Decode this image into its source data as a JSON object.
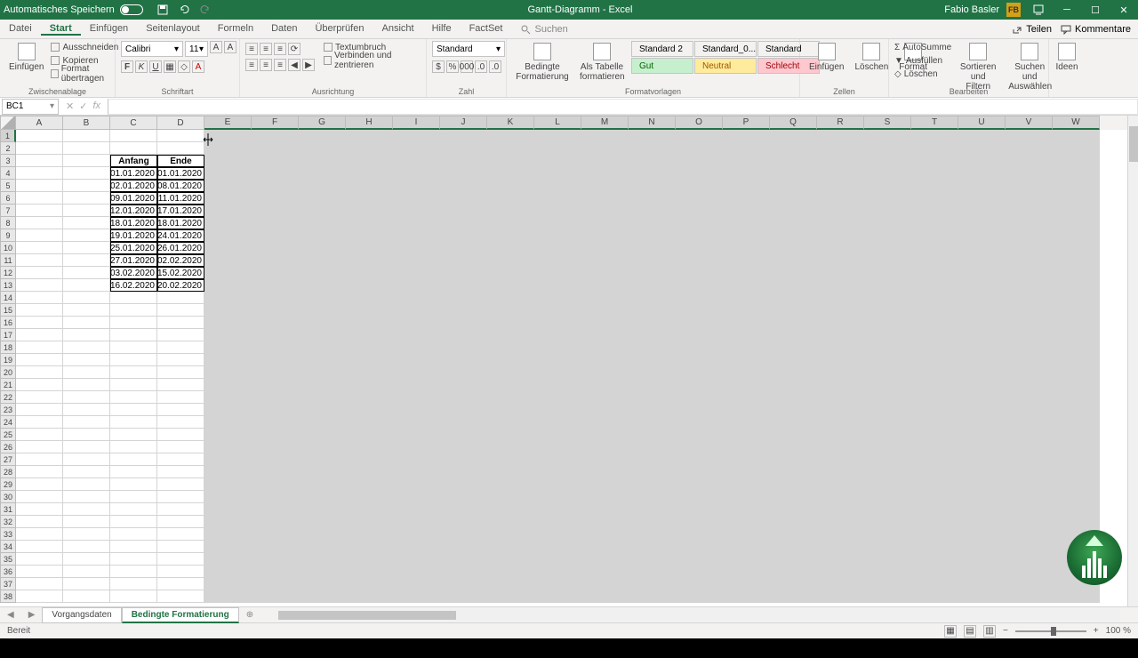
{
  "titlebar": {
    "autosave": "Automatisches Speichern",
    "title": "Gantt-Diagramm - Excel",
    "user": "Fabio Basler",
    "user_initials": "FB"
  },
  "tabs": {
    "items": [
      "Datei",
      "Start",
      "Einfügen",
      "Seitenlayout",
      "Formeln",
      "Daten",
      "Überprüfen",
      "Ansicht",
      "Hilfe",
      "FactSet"
    ],
    "active": 1,
    "search": "Suchen",
    "share": "Teilen",
    "comments": "Kommentare"
  },
  "ribbon": {
    "paste": "Einfügen",
    "cut": "Ausschneiden",
    "copy": "Kopieren",
    "formatpainter": "Format übertragen",
    "clipboard": "Zwischenablage",
    "font": "Schriftart",
    "fontname": "Calibri",
    "fontsize": "11",
    "alignment": "Ausrichtung",
    "wrap": "Textumbruch",
    "merge": "Verbinden und zentrieren",
    "number": "Zahl",
    "numberformat": "Standard",
    "conditional": "Bedingte Formatierung",
    "astable": "Als Tabelle formatieren",
    "styles_label": "Formatvorlagen",
    "styles": [
      {
        "name": "Standard 2"
      },
      {
        "name": "Standard_0..."
      },
      {
        "name": "Standard"
      },
      {
        "name": "Gut"
      },
      {
        "name": "Neutral"
      },
      {
        "name": "Schlecht"
      }
    ],
    "insert": "Einfügen",
    "delete": "Löschen",
    "format": "Format",
    "cells": "Zellen",
    "autosum": "AutoSumme",
    "fill": "Ausfüllen",
    "clear": "Löschen",
    "sort": "Sortieren und Filtern",
    "find": "Suchen und Auswählen",
    "editing": "Bearbeiten",
    "ideas": "Ideen"
  },
  "namebox": "BC1",
  "columns": [
    "A",
    "B",
    "C",
    "D",
    "E",
    "F",
    "G",
    "H",
    "I",
    "J",
    "K",
    "L",
    "M",
    "N",
    "O",
    "P",
    "Q",
    "R",
    "S",
    "T",
    "U",
    "V",
    "W"
  ],
  "selected_from_col": 4,
  "table": {
    "headers": [
      "Anfang",
      "Ende"
    ],
    "rows": [
      [
        "01.01.2020",
        "01.01.2020"
      ],
      [
        "02.01.2020",
        "08.01.2020"
      ],
      [
        "09.01.2020",
        "11.01.2020"
      ],
      [
        "12.01.2020",
        "17.01.2020"
      ],
      [
        "18.01.2020",
        "18.01.2020"
      ],
      [
        "19.01.2020",
        "24.01.2020"
      ],
      [
        "25.01.2020",
        "26.01.2020"
      ],
      [
        "27.01.2020",
        "02.02.2020"
      ],
      [
        "03.02.2020",
        "15.02.2020"
      ],
      [
        "16.02.2020",
        "20.02.2020"
      ]
    ]
  },
  "row_count": 38,
  "sheets": {
    "items": [
      "Vorgangsdaten",
      "Bedingte Formatierung"
    ],
    "active": 1
  },
  "status": {
    "ready": "Bereit",
    "zoom": "100 %"
  }
}
